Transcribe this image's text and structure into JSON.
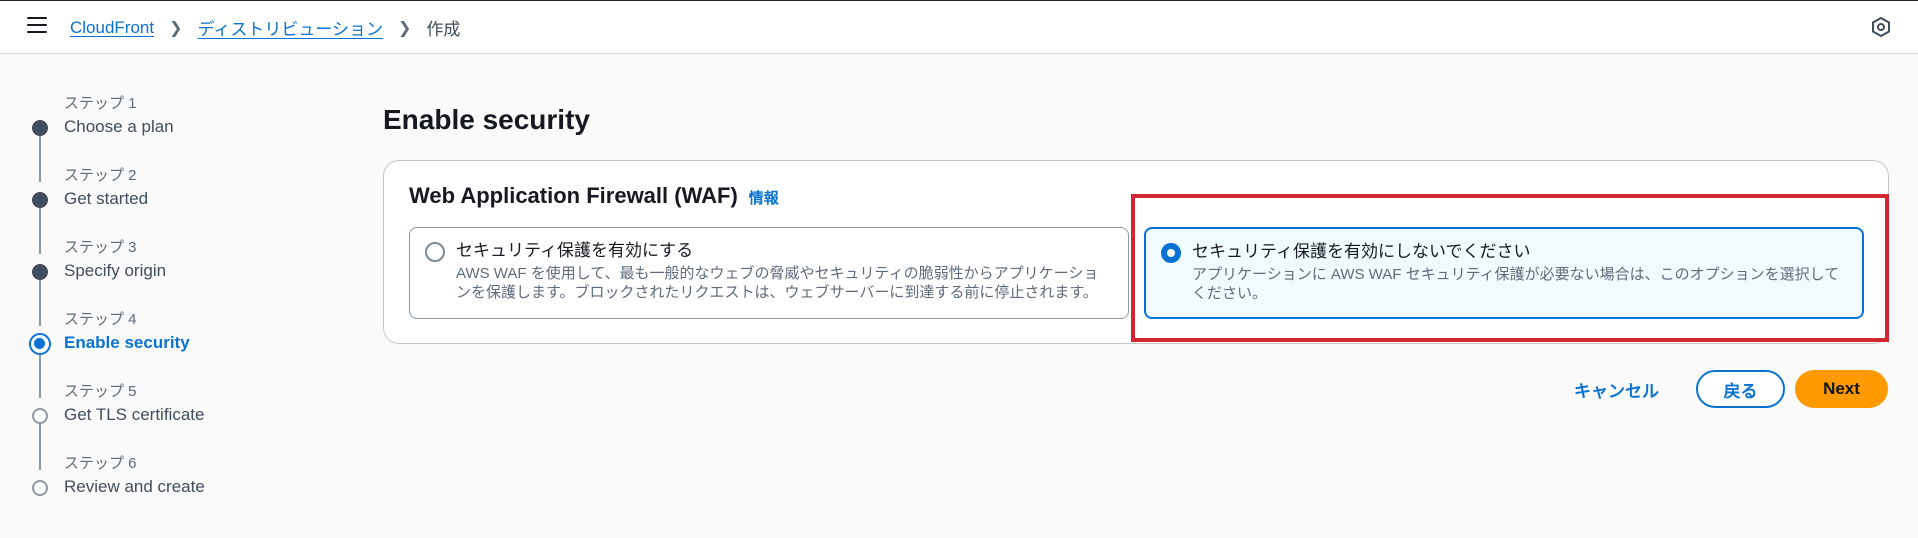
{
  "header": {
    "menu_icon": "hamburger-menu-icon",
    "breadcrumbs": [
      "CloudFront",
      "ディストリビューション",
      "作成"
    ],
    "separator_icon": "chevron-right-icon",
    "right_icon": "hexagon-settings-icon"
  },
  "steps": [
    {
      "number": "ステップ 1",
      "title": "Choose a plan",
      "state": "done"
    },
    {
      "number": "ステップ 2",
      "title": "Get started",
      "state": "done"
    },
    {
      "number": "ステップ 3",
      "title": "Specify origin",
      "state": "done"
    },
    {
      "number": "ステップ 4",
      "title": "Enable security",
      "state": "active"
    },
    {
      "number": "ステップ 5",
      "title": "Get TLS certificate",
      "state": "future"
    },
    {
      "number": "ステップ 6",
      "title": "Review and create",
      "state": "future"
    }
  ],
  "page": {
    "title": "Enable security"
  },
  "waf": {
    "title": "Web Application Firewall (WAF)",
    "info": "情報",
    "options": [
      {
        "title": "セキュリティ保護を有効にする",
        "description": "AWS WAF を使用して、最も一般的なウェブの脅威やセキュリティの脆弱性からアプリケーションを保護します。ブロックされたリクエストは、ウェブサーバーに到達する前に停止されます。",
        "selected": false
      },
      {
        "title": "セキュリティ保護を有効にしないでください",
        "description": "アプリケーションに AWS WAF セキュリティ保護が必要ない場合は、このオプションを選択してください。",
        "selected": true
      }
    ]
  },
  "actions": {
    "cancel": "キャンセル",
    "back": "戻る",
    "next": "Next"
  },
  "colors": {
    "accent": "#0972d3",
    "primary_button": "#ff9900",
    "highlight": "#d22630"
  }
}
